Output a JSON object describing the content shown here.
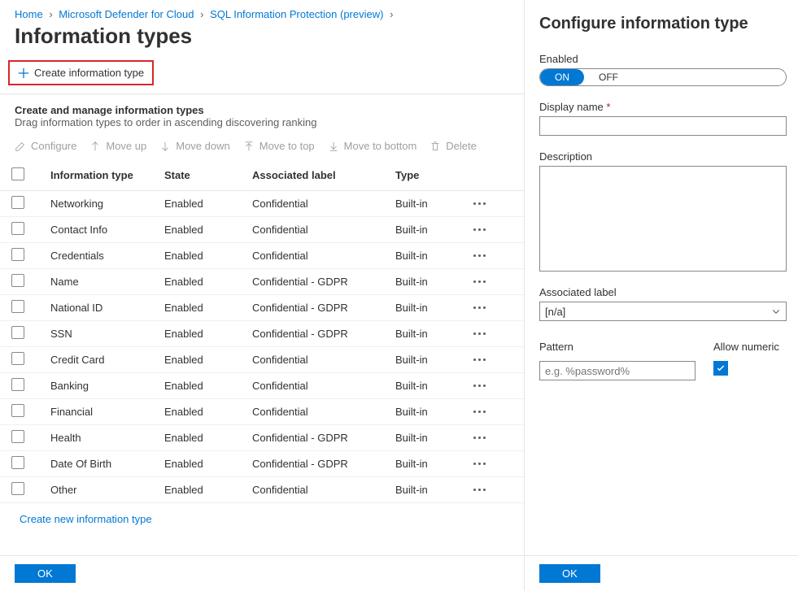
{
  "breadcrumb": {
    "home": "Home",
    "defender": "Microsoft Defender for Cloud",
    "sip": "SQL Information Protection (preview)"
  },
  "page_title": "Information types",
  "create_button": "Create information type",
  "section": {
    "title": "Create and manage information types",
    "desc": "Drag information types to order in ascending discovering ranking"
  },
  "toolbar": {
    "configure": "Configure",
    "move_up": "Move up",
    "move_down": "Move down",
    "move_top": "Move to top",
    "move_bottom": "Move to bottom",
    "delete": "Delete"
  },
  "columns": {
    "info_type": "Information type",
    "state": "State",
    "label": "Associated label",
    "type": "Type"
  },
  "rows": [
    {
      "name": "Networking",
      "state": "Enabled",
      "label": "Confidential",
      "type": "Built-in"
    },
    {
      "name": "Contact Info",
      "state": "Enabled",
      "label": "Confidential",
      "type": "Built-in"
    },
    {
      "name": "Credentials",
      "state": "Enabled",
      "label": "Confidential",
      "type": "Built-in"
    },
    {
      "name": "Name",
      "state": "Enabled",
      "label": "Confidential - GDPR",
      "type": "Built-in"
    },
    {
      "name": "National ID",
      "state": "Enabled",
      "label": "Confidential - GDPR",
      "type": "Built-in"
    },
    {
      "name": "SSN",
      "state": "Enabled",
      "label": "Confidential - GDPR",
      "type": "Built-in"
    },
    {
      "name": "Credit Card",
      "state": "Enabled",
      "label": "Confidential",
      "type": "Built-in"
    },
    {
      "name": "Banking",
      "state": "Enabled",
      "label": "Confidential",
      "type": "Built-in"
    },
    {
      "name": "Financial",
      "state": "Enabled",
      "label": "Confidential",
      "type": "Built-in"
    },
    {
      "name": "Health",
      "state": "Enabled",
      "label": "Confidential - GDPR",
      "type": "Built-in"
    },
    {
      "name": "Date Of Birth",
      "state": "Enabled",
      "label": "Confidential - GDPR",
      "type": "Built-in"
    },
    {
      "name": "Other",
      "state": "Enabled",
      "label": "Confidential",
      "type": "Built-in"
    }
  ],
  "create_link": "Create new information type",
  "ok": "OK",
  "panel": {
    "title": "Configure information type",
    "enabled_label": "Enabled",
    "on": "ON",
    "off": "OFF",
    "display_name": "Display name",
    "description": "Description",
    "associated_label": "Associated label",
    "associated_value": "[n/a]",
    "pattern": "Pattern",
    "pattern_placeholder": "e.g. %password%",
    "allow_numeric": "Allow numeric"
  }
}
